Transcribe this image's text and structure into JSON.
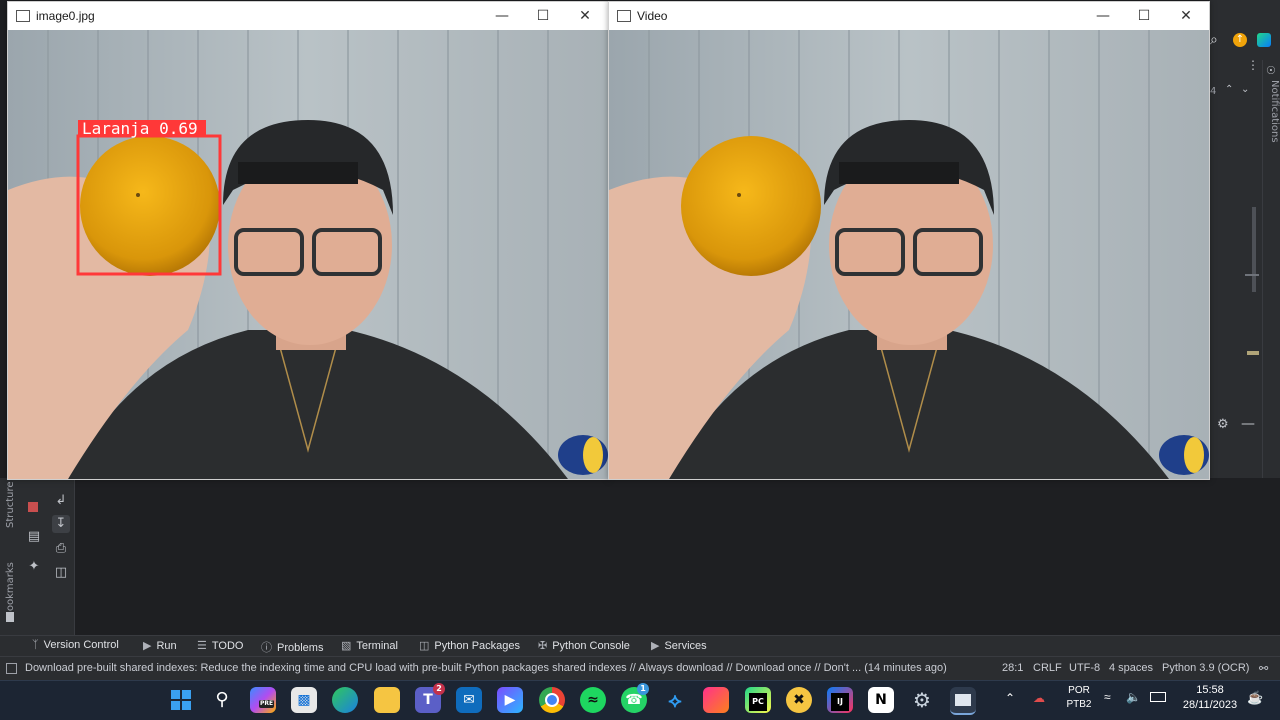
{
  "ide": {
    "notifications_label": "Notifications",
    "structure_label": "Structure",
    "bookmarks_label": "Bookmarks",
    "line_indicator": "4"
  },
  "windows": {
    "left": {
      "title": "image0.jpg",
      "detection_label": "Laranja 0.69",
      "box_color": "#ff3838"
    },
    "right": {
      "title": "Video"
    }
  },
  "tool_tabs": [
    {
      "icon": "version-control-icon",
      "label": "Version Control"
    },
    {
      "icon": "run-icon",
      "label": "Run"
    },
    {
      "icon": "todo-icon",
      "label": "TODO"
    },
    {
      "icon": "problems-icon",
      "label": "Problems"
    },
    {
      "icon": "terminal-icon",
      "label": "Terminal"
    },
    {
      "icon": "python-packages-icon",
      "label": "Python Packages"
    },
    {
      "icon": "python-console-icon",
      "label": "Python Console"
    },
    {
      "icon": "services-icon",
      "label": "Services"
    }
  ],
  "status": {
    "message": "Download pre-built shared indexes: Reduce the indexing time and CPU load with pre-built Python packages shared indexes // Always download // Download once // Don't ... (14 minutes ago)",
    "position": "28:1",
    "line_sep": "CRLF",
    "encoding": "UTF-8",
    "indent": "4 spaces",
    "interpreter": "Python 3.9 (OCR)"
  },
  "taskbar": {
    "apps": [
      "windows-start-icon",
      "search-icon",
      "copilot-icon",
      "store-icon",
      "edge-icon",
      "file-explorer-icon",
      "teams-icon",
      "mail-icon",
      "clipchamp-icon",
      "chrome-icon",
      "spotify-icon",
      "whatsapp-icon",
      "vscode-icon",
      "jetbrains-toolbox-icon",
      "pycharm-icon",
      "app-icon",
      "intellij-icon",
      "notion-icon",
      "settings-icon",
      "python-window-icon"
    ],
    "teams_badge": "2",
    "whatsapp_badge": "1",
    "copilot_tag": "PRE",
    "language_line1": "POR",
    "language_line2": "PTB2",
    "time": "15:58",
    "date": "28/11/2023"
  },
  "colors": {
    "ide_bg": "#1e1f22",
    "panel": "#2b2d30",
    "taskbar": "#1c2533"
  }
}
